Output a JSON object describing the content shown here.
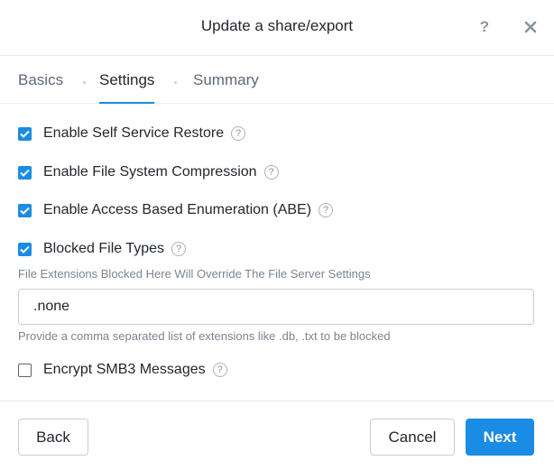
{
  "dialog": {
    "title": "Update a share/export",
    "help_symbol": "?"
  },
  "tabs": [
    {
      "label": "Basics",
      "active": false
    },
    {
      "label": "Settings",
      "active": true
    },
    {
      "label": "Summary",
      "active": false
    }
  ],
  "options": [
    {
      "label": "Enable Self Service Restore",
      "checked": true
    },
    {
      "label": "Enable File System Compression",
      "checked": true
    },
    {
      "label": "Enable Access Based Enumeration (ABE)",
      "checked": true
    },
    {
      "label": "Blocked File Types",
      "checked": true
    },
    {
      "label": "Encrypt SMB3 Messages",
      "checked": false
    }
  ],
  "blocked_types": {
    "description": "File Extensions Blocked Here Will Override The File Server Settings",
    "value": ".none",
    "helper": "Provide a comma separated list of extensions like .db, .txt to be blocked"
  },
  "info_icon_symbol": "?",
  "footer": {
    "back_label": "Back",
    "cancel_label": "Cancel",
    "next_label": "Next"
  },
  "colors": {
    "accent": "#1b8ce3",
    "text": "#22272e",
    "muted": "#7a8591"
  }
}
